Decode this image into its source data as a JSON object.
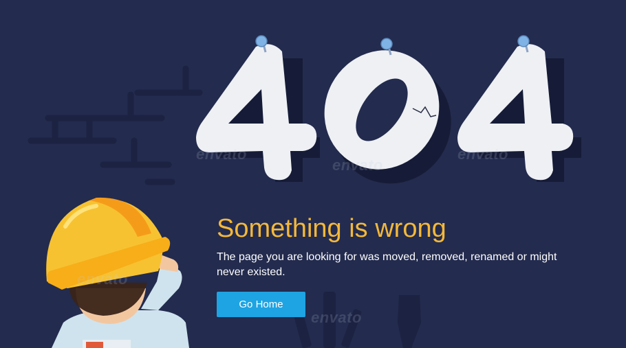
{
  "error": {
    "code_digits": [
      "4",
      "0",
      "4"
    ],
    "headline": "Something is wrong",
    "message": "The page you are looking for was moved, removed, renamed or might never existed.",
    "home_button_label": "Go Home"
  },
  "watermark_text": "envato",
  "colors": {
    "background": "#232b4e",
    "headline": "#f4b83a",
    "button": "#1ea4e3",
    "digits": "#eef0f4",
    "helmet": "#f7c231"
  },
  "icons": [
    "pushpin-icon",
    "helmet-illustration",
    "worker-illustration",
    "tools-illustration",
    "brick-wall-illustration"
  ]
}
